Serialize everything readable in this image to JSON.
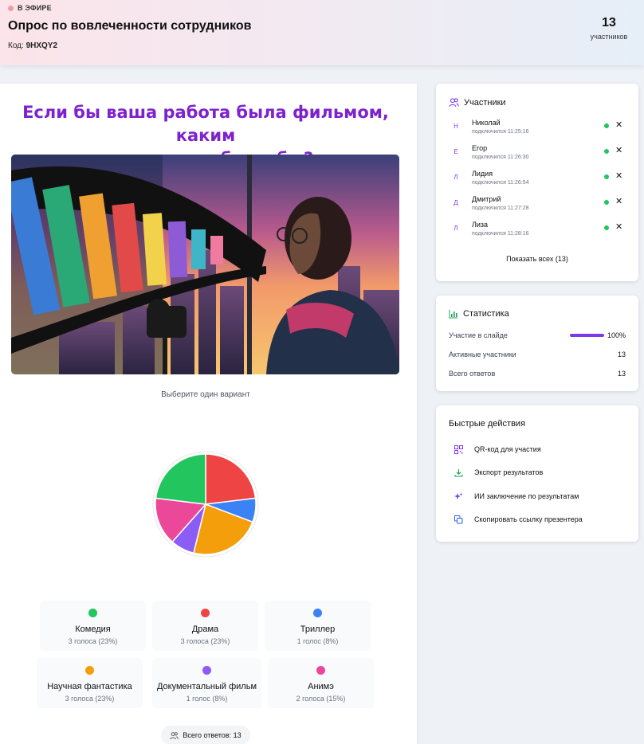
{
  "header": {
    "live_label": "В ЭФИРЕ",
    "title": "Опрос по вовлеченности сотрудников",
    "code_label": "Код:",
    "code_value": "9HXQY2",
    "participants_count": "13",
    "participants_label": "участников"
  },
  "slide": {
    "question_line1": "Если бы ваша работа была фильмом, каким",
    "question_line2": "жанром она была бы?",
    "hint": "Выберите один вариант",
    "options": [
      {
        "name": "Комедия",
        "votes": "3 голоса (23%)",
        "color": "#22c55e",
        "count": 3
      },
      {
        "name": "Драма",
        "votes": "3 голоса (23%)",
        "color": "#ef4444",
        "count": 3
      },
      {
        "name": "Триллер",
        "votes": "1 голос (8%)",
        "color": "#3b82f6",
        "count": 1
      },
      {
        "name": "Научная фантастика",
        "votes": "3 голоса (23%)",
        "color": "#f59e0b",
        "count": 3
      },
      {
        "name": "Документальный фильм",
        "votes": "1 голос (8%)",
        "color": "#8b5cf6",
        "count": 1
      },
      {
        "name": "Анимэ",
        "votes": "2 голоса (15%)",
        "color": "#ec4899",
        "count": 2
      }
    ],
    "total_label": "Всего ответов: 13"
  },
  "participants": {
    "title": "Участники",
    "items": [
      {
        "initial": "Н",
        "name": "Николай",
        "time": "подключился 11:25:16"
      },
      {
        "initial": "Е",
        "name": "Егор",
        "time": "подключился 11:26:30"
      },
      {
        "initial": "Л",
        "name": "Лидия",
        "time": "подключился 11:26:54"
      },
      {
        "initial": "Д",
        "name": "Дмитрий",
        "time": "подключился 11:27:28"
      },
      {
        "initial": "Л",
        "name": "Лиза",
        "time": "подключился 11:28:16"
      }
    ],
    "remove_glyph": "✕",
    "show_all": "Показать всех (13)"
  },
  "stats": {
    "title": "Статистика",
    "rows": [
      {
        "label": "Участие в слайде",
        "value": "100%",
        "fraction": 1.0
      },
      {
        "label": "Активные участники",
        "value": "13"
      },
      {
        "label": "Всего ответов",
        "value": "13"
      }
    ]
  },
  "actions": {
    "title": "Быстрые действия",
    "items": [
      {
        "label": "QR-код для участия",
        "icon": "qr-code-icon"
      },
      {
        "label": "Экспорт результатов",
        "icon": "download-icon"
      },
      {
        "label": "ИИ заключение по результатам",
        "icon": "sparkles-icon"
      },
      {
        "label": "Скопировать ссылку презентера",
        "icon": "copy-icon"
      }
    ]
  },
  "chart_data": {
    "type": "pie",
    "categories": [
      "Комедия",
      "Драма",
      "Триллер",
      "Научная фантастика",
      "Документальный фильм",
      "Анимэ"
    ],
    "values": [
      3,
      3,
      1,
      3,
      1,
      2
    ],
    "colors": [
      "#22c55e",
      "#ef4444",
      "#3b82f6",
      "#f59e0b",
      "#8b5cf6",
      "#ec4899"
    ]
  }
}
